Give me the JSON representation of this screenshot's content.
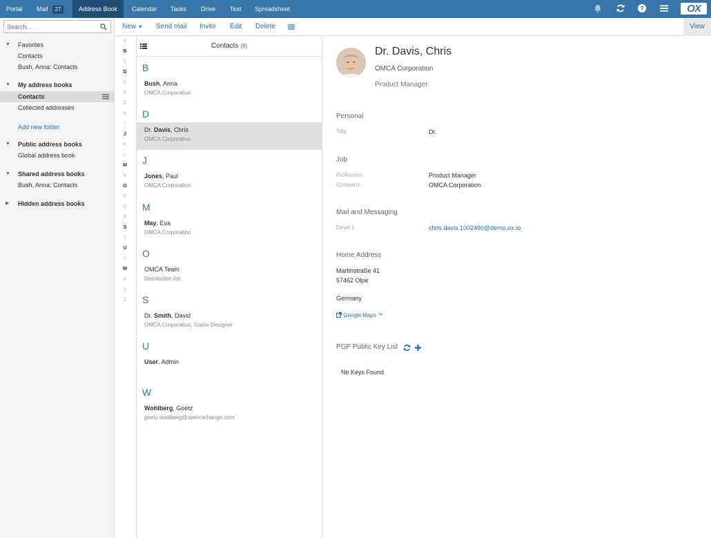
{
  "app_tabs": [
    {
      "label": "Portal"
    },
    {
      "label": "Mail",
      "badge": "27"
    },
    {
      "label": "Address Book",
      "active": true
    },
    {
      "label": "Calendar"
    },
    {
      "label": "Tasks"
    },
    {
      "label": "Drive"
    },
    {
      "label": "Text"
    },
    {
      "label": "Spreadsheet"
    }
  ],
  "top_icons": [
    "bell-icon",
    "refresh-icon",
    "help-icon",
    "menu-icon"
  ],
  "logo": "OX",
  "colors": {
    "topbar": "#3774a8",
    "active_tab": "#1f4e76",
    "link": "#2a6dad"
  },
  "search": {
    "placeholder": "Search..."
  },
  "folders": {
    "favorites": {
      "label": "Favorites",
      "items": [
        "Contacts",
        "Bush, Anna: Contacts"
      ]
    },
    "my_books": {
      "label": "My address books",
      "items": [
        "Contacts",
        "Collected addresses"
      ],
      "selected": "Contacts"
    },
    "add_folder": "Add new folder",
    "public_books": {
      "label": "Public address books",
      "items": [
        "Global address book"
      ]
    },
    "shared_books": {
      "label": "Shared address books",
      "items": [
        "Bush, Anna: Contacts"
      ]
    },
    "hidden_books": {
      "label": "Hidden address books"
    }
  },
  "toolbar": {
    "new": "New",
    "send_mail": "Send mail",
    "invite": "Invite",
    "edit": "Edit",
    "delete": "Delete",
    "view": "View"
  },
  "letters": [
    "A",
    "B",
    "C",
    "D",
    "E",
    "F",
    "G",
    "H",
    "I",
    "J",
    "K",
    "L",
    "M",
    "N",
    "O",
    "P",
    "Q",
    "R",
    "S",
    "T",
    "U",
    "V",
    "W",
    "X",
    "Y",
    "Z"
  ],
  "active_letters": [
    "B",
    "D",
    "J",
    "M",
    "O",
    "S",
    "U",
    "W"
  ],
  "list": {
    "title": "Contacts",
    "count": "(8)",
    "groups": [
      {
        "letter": "B",
        "contacts": [
          {
            "prefix": "",
            "last": "Bush",
            "rest": ", Anna",
            "sub": "OMCA Corporation"
          }
        ]
      },
      {
        "letter": "D",
        "contacts": [
          {
            "prefix": "Dr. ",
            "last": "Davis",
            "rest": ", Chris",
            "sub": "OMCA Corporation",
            "selected": true
          }
        ]
      },
      {
        "letter": "J",
        "contacts": [
          {
            "prefix": "",
            "last": "Jones",
            "rest": ", Paul",
            "sub": "OMCA Corporation"
          }
        ]
      },
      {
        "letter": "M",
        "contacts": [
          {
            "prefix": "",
            "last": "May",
            "rest": ", Eva",
            "sub": "OMCA Corporation"
          }
        ]
      },
      {
        "letter": "O",
        "contacts": [
          {
            "prefix": "",
            "last": "",
            "rest": "OMCA Team",
            "sub": "Distribution list"
          }
        ]
      },
      {
        "letter": "S",
        "contacts": [
          {
            "prefix": "Dr. ",
            "last": "Smith",
            "rest": ", David",
            "sub": "OMCA Corporation, Game Designer"
          }
        ]
      },
      {
        "letter": "U",
        "contacts": [
          {
            "prefix": "",
            "last": "User",
            "rest": ", Admin",
            "sub": ""
          }
        ]
      },
      {
        "letter": "W",
        "contacts": [
          {
            "prefix": "",
            "last": "Wohlberg",
            "rest": ", Goetz",
            "sub": "goetz.wohlberg@open-xchange.com"
          }
        ]
      }
    ]
  },
  "detail": {
    "name": "Dr. Davis, Chris",
    "company": "OMCA Corporation",
    "position": "Product Manager",
    "personal": {
      "heading": "Personal",
      "title_label": "Title",
      "title_value": "Dr."
    },
    "job": {
      "heading": "Job",
      "profession_label": "Profession",
      "profession_value": "Product Manager",
      "company_label": "Company",
      "company_value": "OMCA Corporation"
    },
    "messaging": {
      "heading": "Mail and Messaging",
      "email_label": "Email 1",
      "email_value": "chris.davis.1002490@demo.ox.io"
    },
    "home": {
      "heading": "Home Address",
      "street": "Martinstraße 41",
      "city": "57462 Olpe",
      "country": "Germany",
      "maps": "Google Maps ™"
    },
    "pgp": {
      "heading": "PGP Public Key List",
      "empty": "No Keys Found"
    }
  }
}
